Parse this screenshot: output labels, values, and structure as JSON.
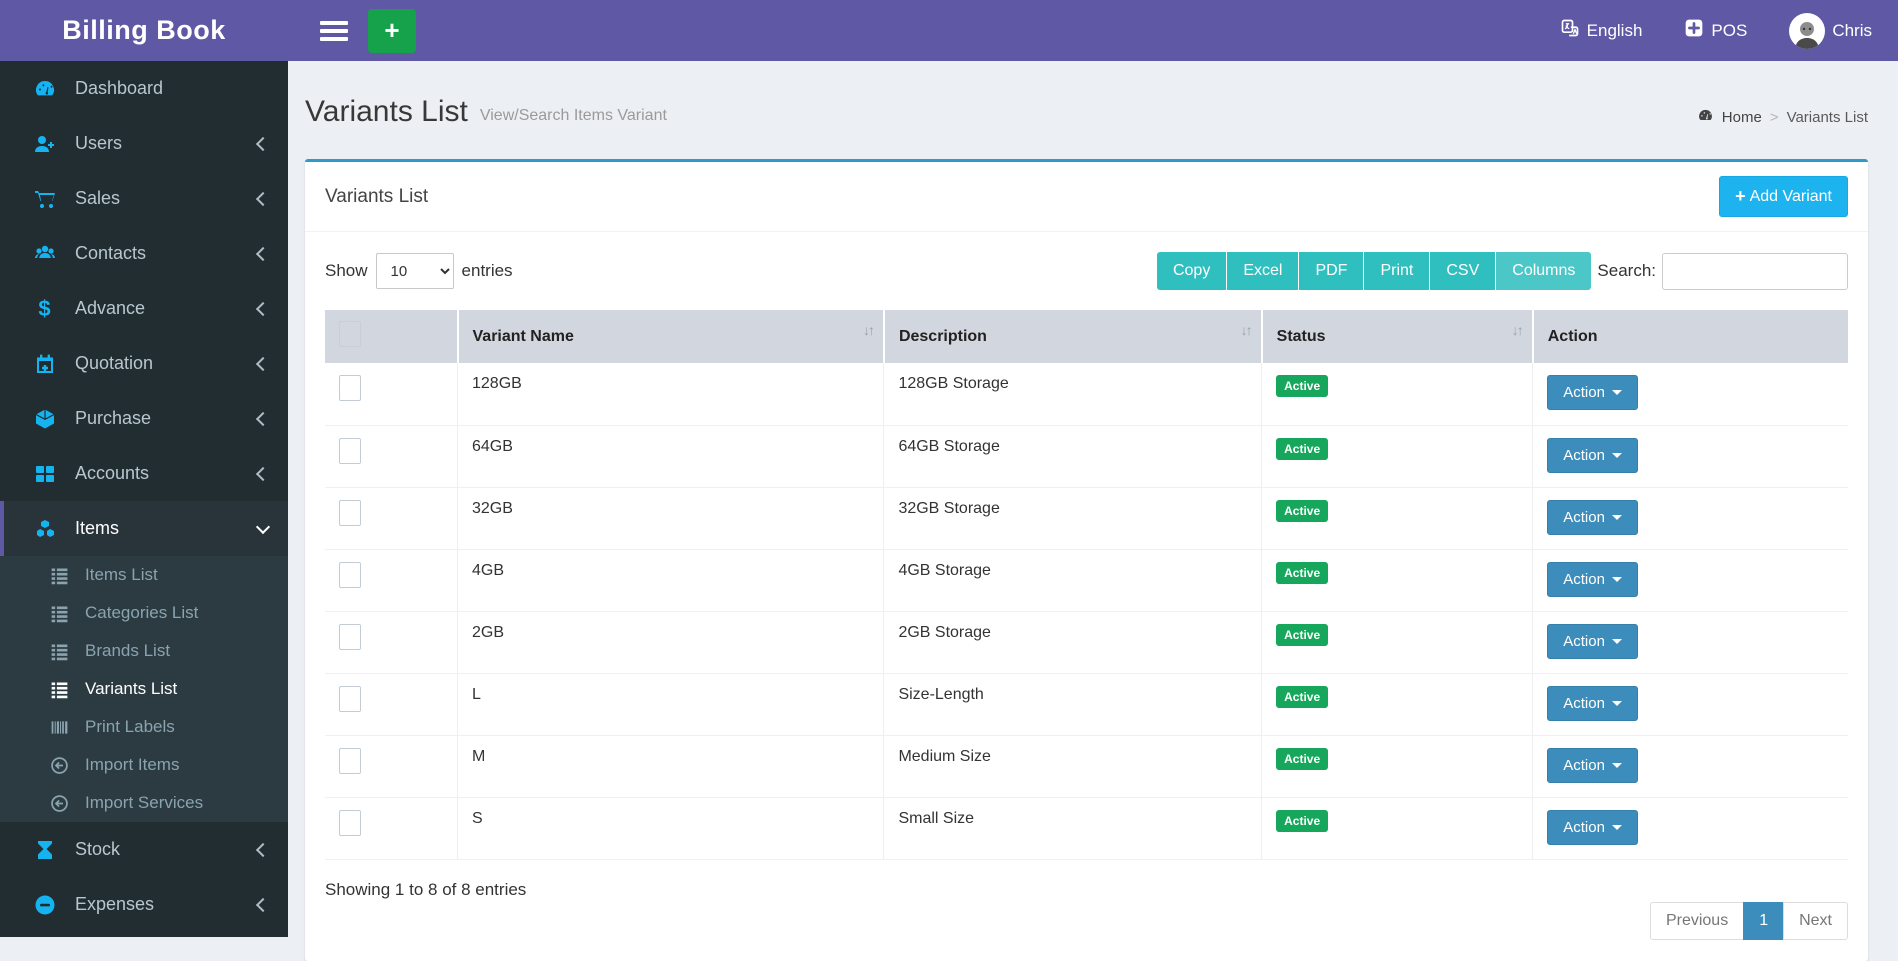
{
  "app": {
    "title": "Billing Book"
  },
  "topbar": {
    "language": "English",
    "pos": "POS",
    "user": "Chris"
  },
  "sidebar": {
    "items": [
      {
        "id": "dashboard",
        "label": "Dashboard",
        "icon": "gauge-icon"
      },
      {
        "id": "users",
        "label": "Users",
        "icon": "user-plus-icon",
        "chevron": "left"
      },
      {
        "id": "sales",
        "label": "Sales",
        "icon": "cart-icon",
        "chevron": "left"
      },
      {
        "id": "contacts",
        "label": "Contacts",
        "icon": "users-icon",
        "chevron": "left"
      },
      {
        "id": "advance",
        "label": "Advance",
        "icon": "dollar-icon",
        "chevron": "left"
      },
      {
        "id": "quotation",
        "label": "Quotation",
        "icon": "calendar-plus-icon",
        "chevron": "left"
      },
      {
        "id": "purchase",
        "label": "Purchase",
        "icon": "cube-icon",
        "chevron": "left"
      },
      {
        "id": "accounts",
        "label": "Accounts",
        "icon": "grid-icon",
        "chevron": "left"
      },
      {
        "id": "items",
        "label": "Items",
        "icon": "cubes-icon",
        "chevron": "down",
        "active": true,
        "children": [
          {
            "id": "items-list",
            "label": "Items List",
            "icon": "list-icon"
          },
          {
            "id": "categories-list",
            "label": "Categories List",
            "icon": "list-icon"
          },
          {
            "id": "brands-list",
            "label": "Brands List",
            "icon": "list-icon"
          },
          {
            "id": "variants-list",
            "label": "Variants List",
            "icon": "list-icon",
            "active": true
          },
          {
            "id": "print-labels",
            "label": "Print Labels",
            "icon": "barcode-icon"
          },
          {
            "id": "import-items",
            "label": "Import Items",
            "icon": "arrow-circle-left-icon"
          },
          {
            "id": "import-services",
            "label": "Import Services",
            "icon": "arrow-circle-left-icon"
          }
        ]
      },
      {
        "id": "stock",
        "label": "Stock",
        "icon": "hourglass-icon",
        "chevron": "left"
      },
      {
        "id": "expenses",
        "label": "Expenses",
        "icon": "minus-circle-icon",
        "chevron": "left"
      }
    ]
  },
  "page": {
    "title": "Variants List",
    "subtitle": "View/Search Items Variant",
    "breadcrumb": {
      "home": "Home",
      "separator": ">",
      "current": "Variants List"
    }
  },
  "card": {
    "title": "Variants List",
    "add_button": "Add Variant",
    "add_plus": "+"
  },
  "toolbar": {
    "show_label": "Show",
    "page_length": "10",
    "entries_label": "entries",
    "export_buttons": [
      "Copy",
      "Excel",
      "PDF",
      "Print",
      "CSV",
      "Columns"
    ],
    "search_label": "Search:",
    "search_value": ""
  },
  "table": {
    "columns": [
      "Variant Name",
      "Description",
      "Status",
      "Action"
    ],
    "sort_icon": "↓↑",
    "rows": [
      {
        "name": "128GB",
        "description": "128GB Storage",
        "status": "Active",
        "action": "Action"
      },
      {
        "name": "64GB",
        "description": "64GB Storage",
        "status": "Active",
        "action": "Action"
      },
      {
        "name": "32GB",
        "description": "32GB Storage",
        "status": "Active",
        "action": "Action"
      },
      {
        "name": "4GB",
        "description": "4GB Storage",
        "status": "Active",
        "action": "Action"
      },
      {
        "name": "2GB",
        "description": "2GB Storage",
        "status": "Active",
        "action": "Action"
      },
      {
        "name": "L",
        "description": "Size-Length",
        "status": "Active",
        "action": "Action"
      },
      {
        "name": "M",
        "description": "Medium Size",
        "status": "Active",
        "action": "Action"
      },
      {
        "name": "S",
        "description": "Small Size",
        "status": "Active",
        "action": "Action"
      }
    ]
  },
  "footer": {
    "showing_text": "Showing 1 to 8 of 8 entries",
    "pagination": {
      "previous": "Previous",
      "page": "1",
      "next": "Next"
    }
  },
  "colors": {
    "brand_purple": "#5f59a5",
    "sidebar_dark": "#222d32",
    "sidebar_icon_cyan": "#15b4f1",
    "card_top_border": "#2e9bc7",
    "add_button_blue": "#1db3ef",
    "export_teal": "#30bfbf",
    "status_green": "#16a75c",
    "action_blue": "#3c8dbc",
    "green_plus": "#16a24b",
    "table_header_bg": "#d2d6de"
  }
}
